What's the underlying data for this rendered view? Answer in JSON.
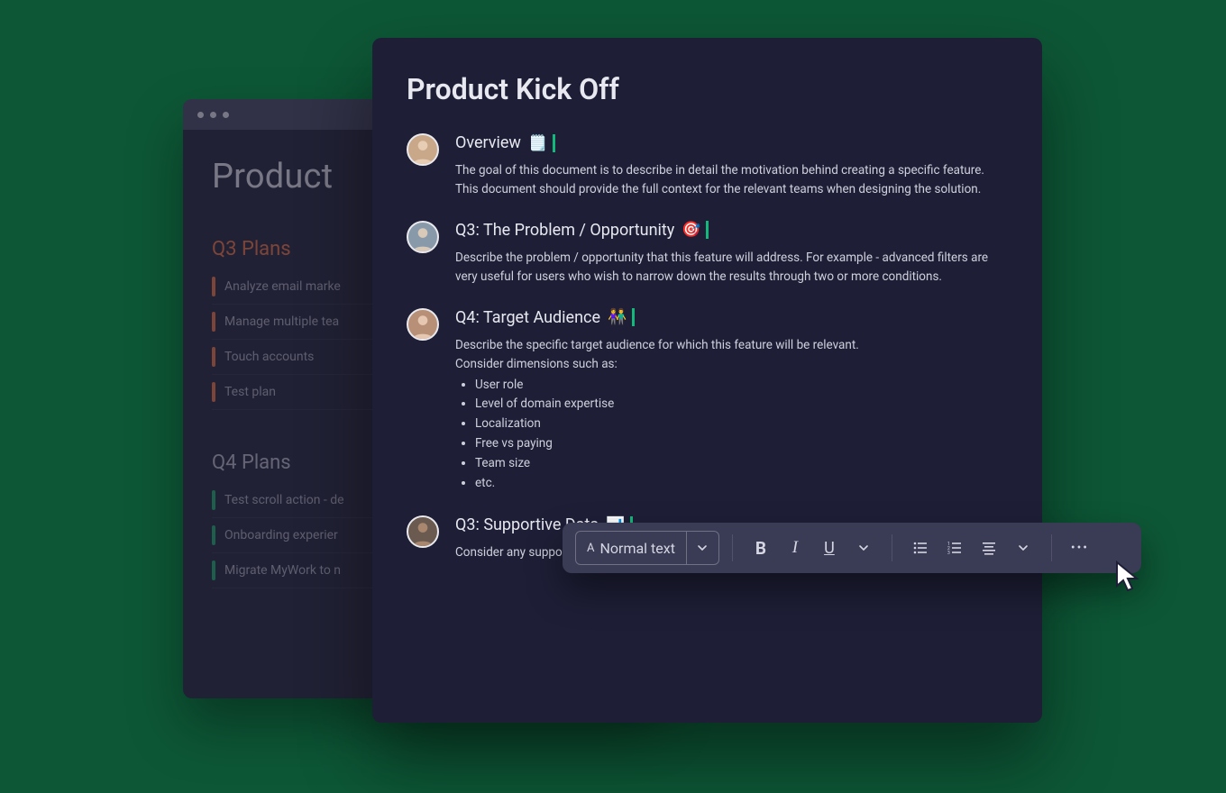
{
  "back": {
    "title": "Product",
    "s1": {
      "title": "Q3 Plans",
      "items": [
        "Analyze email marke",
        "Manage multiple tea",
        "Touch accounts",
        "Test plan"
      ]
    },
    "s2": {
      "title": "Q4 Plans",
      "items": [
        "Test scroll action - de",
        "Onboarding experier",
        "Migrate MyWork to n"
      ]
    }
  },
  "front": {
    "title": "Product Kick Off",
    "sections": [
      {
        "heading": "Overview",
        "emoji": "🗒️",
        "body": "The goal of this document is to describe in detail the motivation behind creating a specific feature. This document should provide the full context for the relevant teams when designing the solution."
      },
      {
        "heading": "Q3: The Problem / Opportunity",
        "emoji": "🎯",
        "body": "Describe the problem / opportunity that this feature will address. For example - advanced filters are very useful for users who wish to narrow down the results through two or more conditions."
      },
      {
        "heading": "Q4: Target Audience",
        "emoji": "👫",
        "body_intro": "Describe the specific target audience for which this feature will be relevant.",
        "body_consider": "Consider dimensions such as:",
        "bullets": [
          "User role",
          "Level of domain expertise",
          "Localization",
          "Free vs paying",
          "Team size",
          "etc."
        ]
      },
      {
        "heading": "Q3: Supportive Data",
        "emoji": "📊",
        "body": "Consider any supportive data confirming why you're addressing the problem/opportunity"
      }
    ]
  },
  "toolbar": {
    "style_label": "Normal text",
    "bold": "B",
    "italic": "I",
    "underline": "U",
    "more": "•••"
  }
}
